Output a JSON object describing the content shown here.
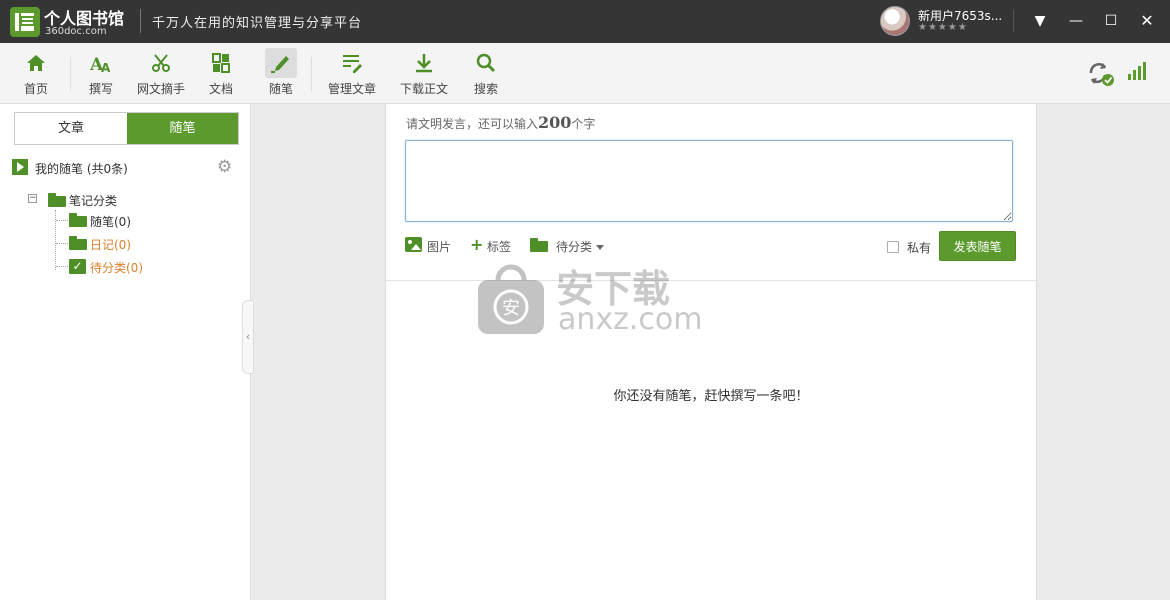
{
  "app": {
    "name": "个人图书馆",
    "domain": "360doc.com",
    "slogan": "千万人在用的知识管理与分享平台"
  },
  "user": {
    "name": "新用户7653s...",
    "stars": "★★★★★"
  },
  "window_controls": {
    "menu": "▼",
    "minimize": "—",
    "maximize": "☐",
    "close": "✕"
  },
  "toolbar": {
    "items": [
      {
        "label": "首页",
        "icon": "home-icon"
      },
      {
        "label": "撰写",
        "icon": "write-icon"
      },
      {
        "label": "网文摘手",
        "icon": "scissors-icon"
      },
      {
        "label": "文档",
        "icon": "document-icon"
      },
      {
        "label": "随笔",
        "icon": "pencil-icon",
        "active": true
      },
      {
        "label": "管理文章",
        "icon": "manage-icon"
      },
      {
        "label": "下载正文",
        "icon": "download-icon"
      },
      {
        "label": "搜索",
        "icon": "search-icon"
      }
    ],
    "right_icons": [
      "sync-icon",
      "signal-icon"
    ]
  },
  "sidebar": {
    "tabs": [
      {
        "label": "文章",
        "active": false
      },
      {
        "label": "随笔",
        "active": true
      }
    ],
    "my_notes_label": "我的随笔 (共0条)",
    "tree": {
      "root": "笔记分类",
      "children": [
        {
          "label": "随笔(0)",
          "color": "#333333"
        },
        {
          "label": "日记(0)",
          "color": "#d9822b"
        },
        {
          "label": "待分类(0)",
          "color": "#d9822b"
        }
      ]
    },
    "collapse_glyph": "‹"
  },
  "composer": {
    "hint_prefix": "请文明发言，还可以输入",
    "hint_count": "200",
    "hint_suffix": "个字",
    "value": "",
    "attach_picture": "图片",
    "attach_tag": "标签",
    "category_select": "待分类",
    "private_label": "私有",
    "publish_button": "发表随笔"
  },
  "empty_message": "你还没有随笔，赶快撰写一条吧！",
  "watermark": {
    "cn": "安下载",
    "en": "anxz.com"
  },
  "colors": {
    "accent": "#5c9a2e",
    "titlebar": "#353535",
    "orange": "#d9822b"
  }
}
